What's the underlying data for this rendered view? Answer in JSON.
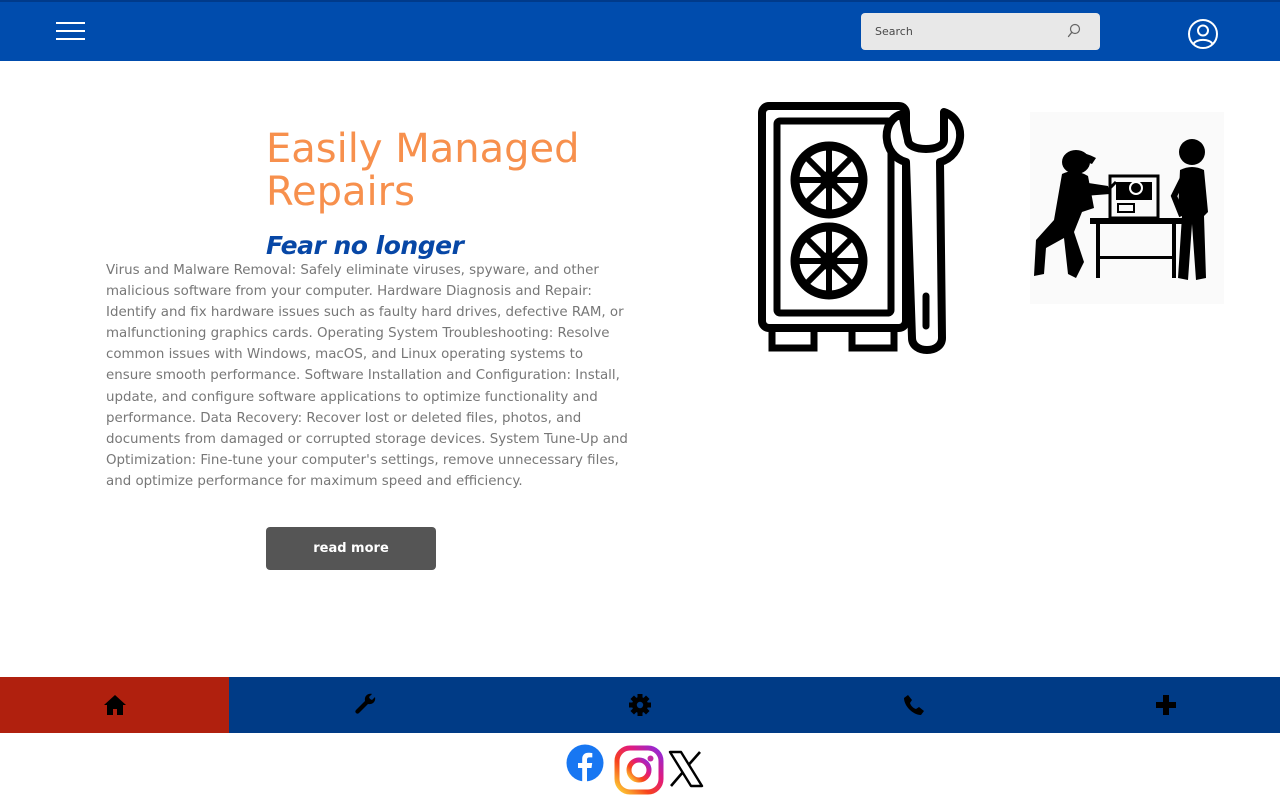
{
  "header": {
    "menu_icon": "hamburger-menu-icon",
    "search": {
      "placeholder": "Search",
      "icon": "search-icon"
    },
    "user_icon": "user-account-icon"
  },
  "hero": {
    "title": "Easily Managed Repairs",
    "subtitle": "Fear no longer",
    "body": "Virus and Malware Removal: Safely eliminate viruses, spyware, and other malicious software from your computer. Hardware Diagnosis and Repair: Identify and fix hardware issues such as faulty hard drives, defective RAM, or malfunctioning graphics cards. Operating System Troubleshooting: Resolve common issues with Windows, macOS, and Linux operating systems to ensure smooth performance. Software Installation and Configuration: Install, update, and configure software applications to optimize functionality and performance. Data Recovery: Recover lost or deleted files, photos, and documents from damaged or corrupted storage devices. System Tune-Up and Optimization: Fine-tune your computer's settings, remove unnecessary files, and optimize performance for maximum speed and efficiency.",
    "button_label": "read more",
    "images": [
      "pc-repair-wrench-icon",
      "technicians-repairing-computer-illustration"
    ]
  },
  "bottom_nav": {
    "items": [
      {
        "icon": "home-icon",
        "active": true
      },
      {
        "icon": "wrench-icon",
        "active": false
      },
      {
        "icon": "gear-icon",
        "active": false
      },
      {
        "icon": "phone-icon",
        "active": false
      },
      {
        "icon": "plus-icon",
        "active": false
      }
    ]
  },
  "social": [
    "facebook-icon",
    "instagram-icon",
    "x-icon"
  ],
  "colors": {
    "header_bg": "#004cad",
    "title": "#f7904d",
    "subtitle": "#0747a6",
    "body_text": "#777777",
    "button_bg": "#555555",
    "nav_bg": "#003b86",
    "nav_active": "#b0200e"
  }
}
